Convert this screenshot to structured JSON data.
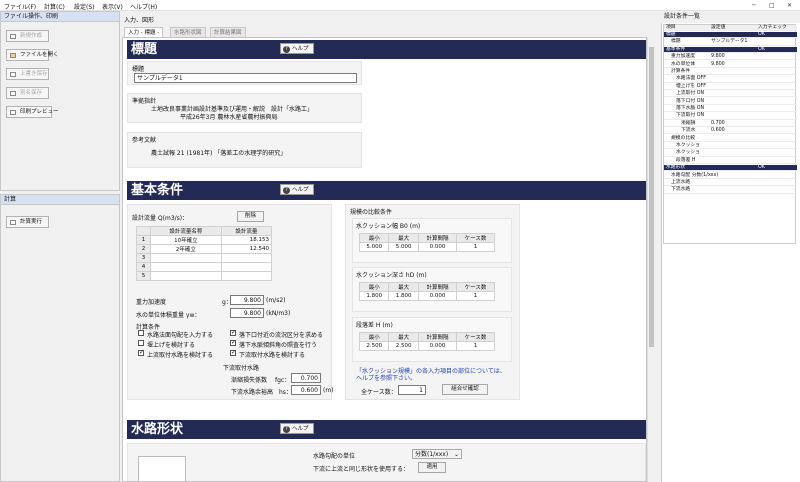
{
  "menu": [
    "ファイル(F)",
    "計算(C)",
    "設定(S)",
    "表示(V)",
    "ヘルプ(H)"
  ],
  "window_controls": {
    "minimize": "─",
    "maximize": "□",
    "close": "✕"
  },
  "left_panel": {
    "file_header": "ファイル操作、印刷",
    "buttons": [
      {
        "label": "新規作成",
        "icon": "new-file-icon",
        "disabled": true
      },
      {
        "label": "ファイルを開く",
        "icon": "open-folder-icon",
        "disabled": false
      },
      {
        "label": "上書き保存",
        "icon": "save-icon",
        "disabled": true
      },
      {
        "label": "別名保存",
        "icon": "save-as-icon",
        "disabled": true
      },
      {
        "label": "印刷プレビュー",
        "icon": "print-icon",
        "disabled": false
      }
    ],
    "calc_header": "計算",
    "calc_button": "計算実行"
  },
  "center": {
    "title": "入力、図形",
    "tabs": [
      "入力 - 標題 -",
      "水路形状図",
      "計算結果図"
    ],
    "help_label": "ヘルプ",
    "help_q": "?",
    "heading": {
      "title": "標題",
      "label": "標題",
      "value": "サンプルデータ1",
      "standard_label": "準拠指針",
      "standard_line1": "土地改良事業計画設計基準及び運用・解説　設計「水路工」",
      "standard_line2": "平成26年3月 農林水産省農村振興局",
      "ref_label": "参考文献",
      "ref_line1": "農土試報 21 (1981年) 「落差工の水理学的研究」"
    },
    "basic": {
      "title": "基本条件",
      "flow_label": "設計流量 Q(m3/s)：",
      "delete_button": "削除",
      "flow_headers": [
        "",
        "設計流量名称",
        "設計流量"
      ],
      "flow_rows": [
        [
          "1",
          "10年確立",
          "18.153"
        ],
        [
          "2",
          "2年確立",
          "12.540"
        ],
        [
          "3",
          "",
          ""
        ],
        [
          "4",
          "",
          ""
        ],
        [
          "5",
          "",
          ""
        ]
      ],
      "gravity_label": "重力加速度",
      "gravity_sym": "g：",
      "gravity_value": "9.800",
      "gravity_unit": "(m/s2)",
      "weight_label": "水の単位体積重量 γw：",
      "weight_value": "9.800",
      "weight_unit": "(kN/m3)",
      "calc_cond_label": "計算条件",
      "checks": [
        {
          "label": "水路法面勾配を入力する",
          "on": false
        },
        {
          "label": "落下口付近の流況区分を求める",
          "on": true
        },
        {
          "label": "堰上げを検討する",
          "on": false
        },
        {
          "label": "落下水脈傾斜角の照査を行う",
          "on": true
        },
        {
          "label": "上流取付水路を検討する",
          "on": true
        },
        {
          "label": "下流取付水路を検討する",
          "on": true
        }
      ],
      "down_label": "下流取付水路",
      "loss_label": "漸縮損失係数",
      "loss_sym": "fgc：",
      "loss_value": "0.700",
      "down_depth_label": "下流水路余裕高",
      "down_depth_sym": "hs：",
      "down_depth_value": "0.600",
      "down_depth_unit": "(m)",
      "scale_title": "規模の比較条件",
      "width_title": "水クッション幅 B0 (m)",
      "depth_title": "水クッション深さ hD (m)",
      "drop_title": "段落差 H (m)",
      "range_headers": [
        "最小",
        "最大",
        "計算間隔",
        "ケース数"
      ],
      "width_row": [
        "5.000",
        "5.000",
        "0.000",
        "1"
      ],
      "depth_row": [
        "1.800",
        "1.800",
        "0.000",
        "1"
      ],
      "drop_row": [
        "2.500",
        "2.500",
        "0.000",
        "1"
      ],
      "note_line1": "「水クッション規模」の各入力項目の部位については、",
      "note_line2": "ヘルプを参照下さい。",
      "total_label": "全ケース数：",
      "total_value": "1",
      "combo_button": "組合せ確認"
    },
    "channel": {
      "title": "水路形状",
      "slope_label": "水路勾配の単位",
      "slope_value": "分数(1/xxx)",
      "apply_label": "下流に上流と同じ形状を使用する：",
      "apply_button": "適用"
    }
  },
  "right_panel": {
    "title": "設計条件一覧",
    "headers": [
      "項目",
      "設定値",
      "入力チェック"
    ],
    "rows": [
      {
        "item": "標題",
        "value": "",
        "check": "OK",
        "hl": true,
        "indent": 1
      },
      {
        "item": "標題",
        "value": "サンプルデータ1",
        "check": "",
        "hl": false,
        "indent": 2
      },
      {
        "item": "基本条件",
        "value": "",
        "check": "OK",
        "hl": true,
        "indent": 1
      },
      {
        "item": "重力加速度",
        "value": "9.800",
        "check": "",
        "hl": false,
        "indent": 2
      },
      {
        "item": "水の単位体",
        "value": "9.800",
        "check": "",
        "hl": false,
        "indent": 2
      },
      {
        "item": "計算条件",
        "value": "",
        "check": "",
        "hl": false,
        "indent": 2
      },
      {
        "item": "水路法面 OFF",
        "value": "",
        "check": "",
        "hl": false,
        "indent": 3
      },
      {
        "item": "堰上げを OFF",
        "value": "",
        "check": "",
        "hl": false,
        "indent": 3
      },
      {
        "item": "上流取付 ON",
        "value": "",
        "check": "",
        "hl": false,
        "indent": 3
      },
      {
        "item": "落下口付 ON",
        "value": "",
        "check": "",
        "hl": false,
        "indent": 3
      },
      {
        "item": "落下水脈 ON",
        "value": "",
        "check": "",
        "hl": false,
        "indent": 3
      },
      {
        "item": "下流取付 ON",
        "value": "",
        "check": "",
        "hl": false,
        "indent": 3
      },
      {
        "item": "漸縮損",
        "value": "0.700",
        "check": "",
        "hl": false,
        "indent": 4
      },
      {
        "item": "下流水",
        "value": "0.600",
        "check": "",
        "hl": false,
        "indent": 4
      },
      {
        "item": "規模の比較",
        "value": "",
        "check": "",
        "hl": false,
        "indent": 2
      },
      {
        "item": "水クッショ",
        "value": "",
        "check": "",
        "hl": false,
        "indent": 3
      },
      {
        "item": "水クッショ",
        "value": "",
        "check": "",
        "hl": false,
        "indent": 3
      },
      {
        "item": "段落差 H",
        "value": "",
        "check": "",
        "hl": false,
        "indent": 3
      },
      {
        "item": "水路形状",
        "value": "",
        "check": "OK",
        "hl": true,
        "indent": 1
      },
      {
        "item": "水路勾配 分数(1/xxx)",
        "value": "",
        "check": "",
        "hl": false,
        "indent": 2
      },
      {
        "item": "上流水路",
        "value": "",
        "check": "",
        "hl": false,
        "indent": 2
      },
      {
        "item": "下流水路",
        "value": "",
        "check": "",
        "hl": false,
        "indent": 2
      }
    ]
  },
  "colors": {
    "section_bar": "#232a55",
    "highlight_row": "#232a55",
    "note_text": "#2040c0"
  }
}
